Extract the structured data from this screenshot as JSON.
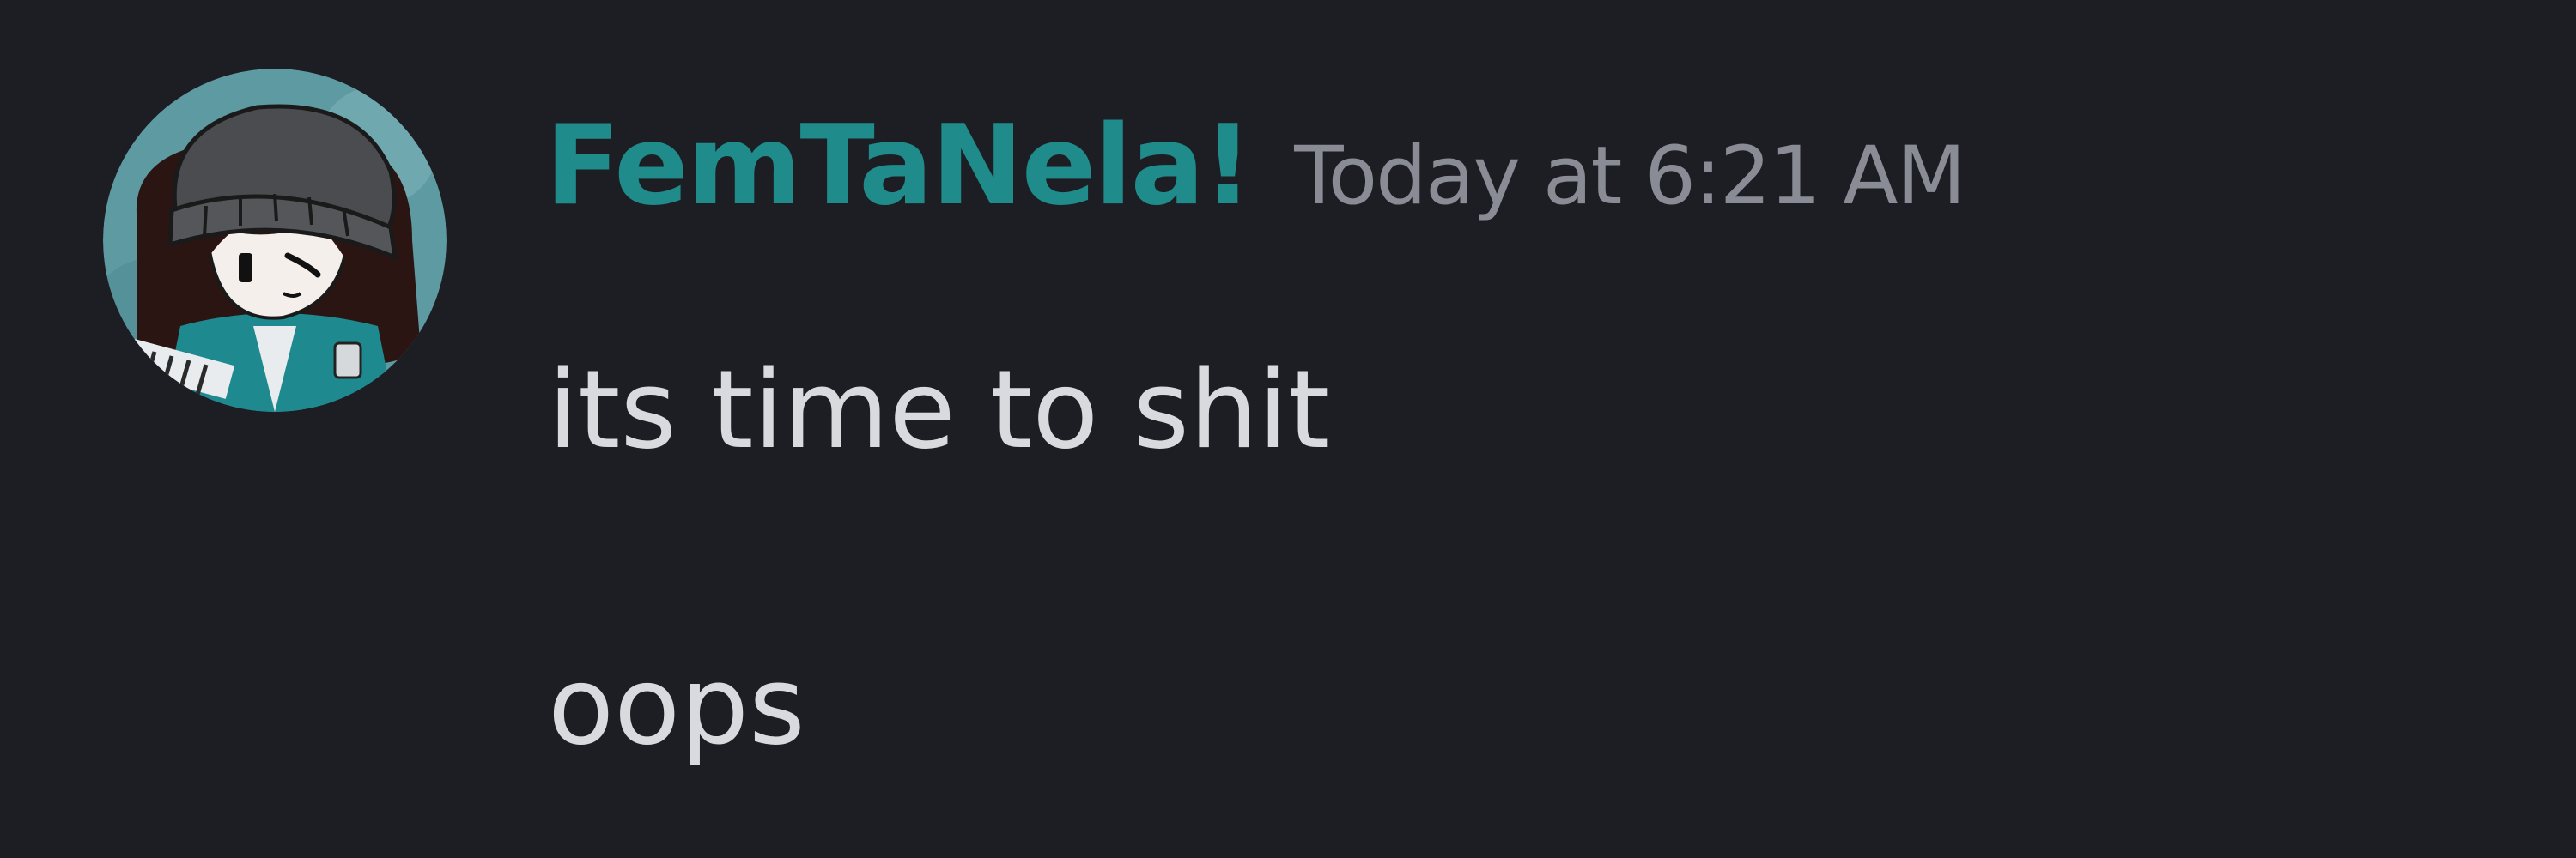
{
  "message": {
    "username": "FemTaNela!",
    "timestamp": "Today at 6:21 AM",
    "lines": [
      "its time to shit",
      "oops"
    ]
  },
  "colors": {
    "background": "#1d1e24",
    "username": "#1f8b8a",
    "timestamp": "#8a8c95",
    "message_text": "#d9dade"
  },
  "icons": {
    "avatar": "user-avatar-drawn-girl-beanie"
  }
}
